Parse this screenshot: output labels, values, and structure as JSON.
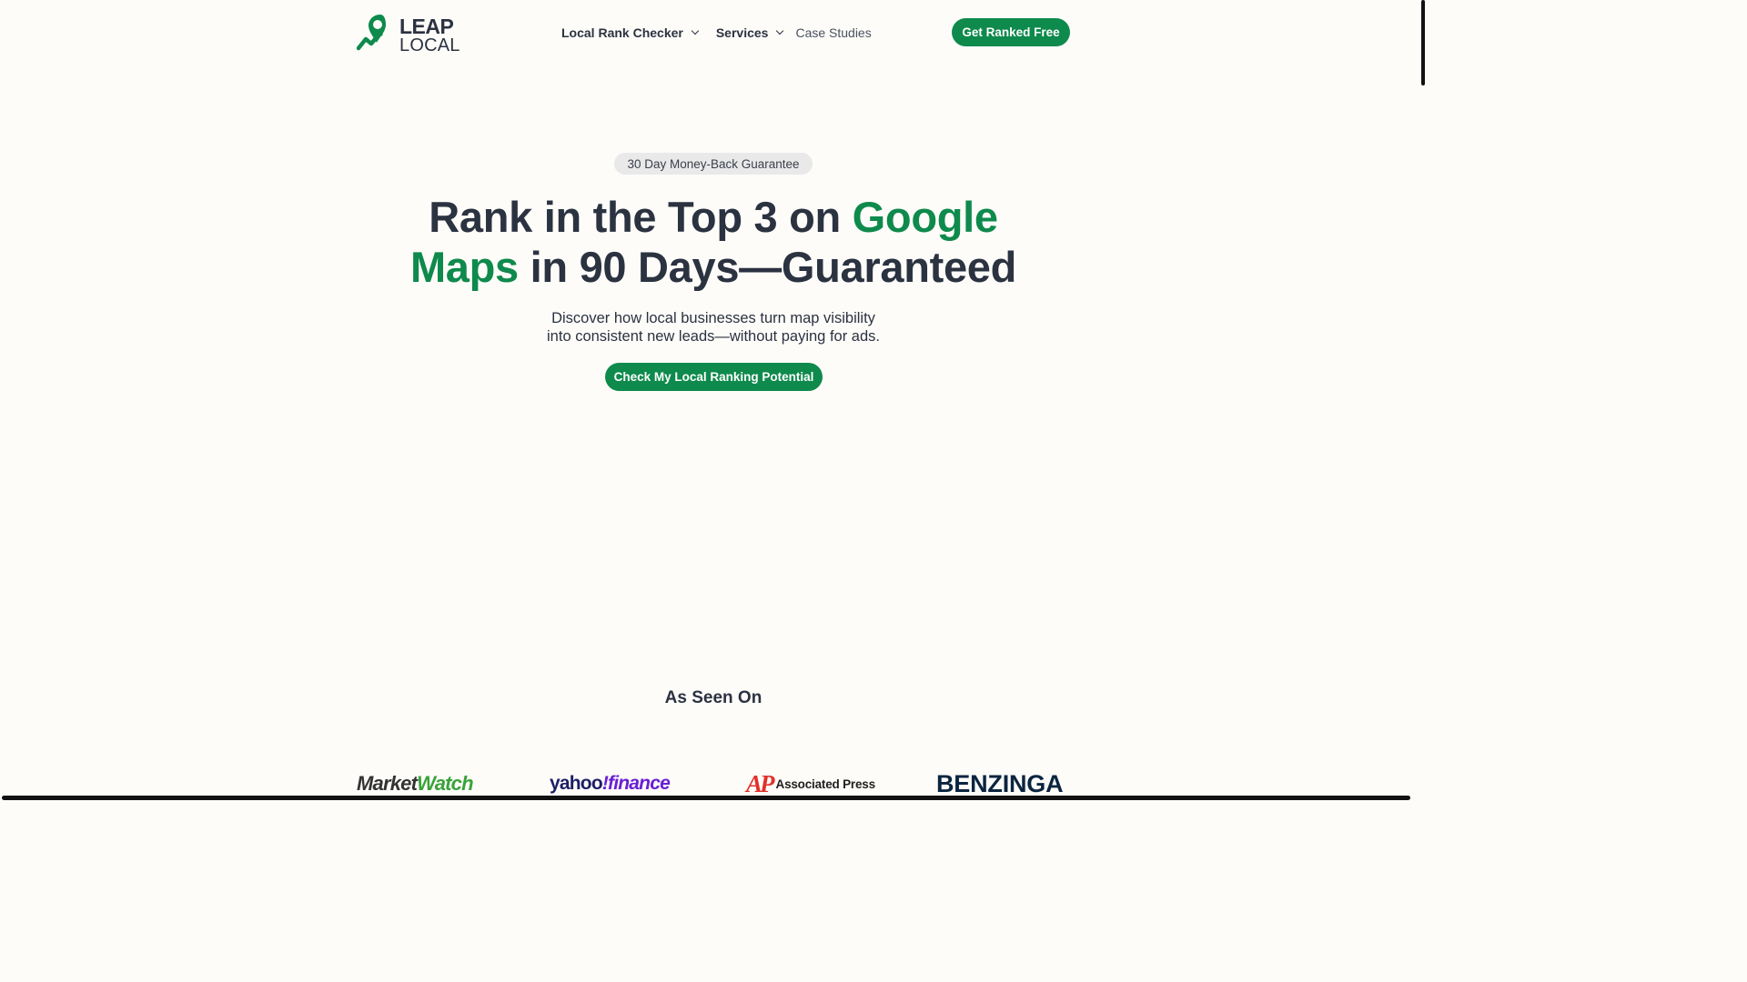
{
  "header": {
    "logo": {
      "line1": "LEAP",
      "line2": "LOCAL"
    },
    "nav": [
      {
        "label": "Local Rank Checker"
      },
      {
        "label": "Services"
      },
      {
        "label": "Case Studies"
      }
    ],
    "cta_label": "Get Ranked Free"
  },
  "hero": {
    "badge": "30 Day Money-Back Guarantee",
    "headline": {
      "part1": "Rank in the Top 3 on ",
      "green1": "Google",
      "green2": "Maps",
      "part2": " in 90 Days—Guaranteed"
    },
    "subtitle": {
      "line1": "Discover how local businesses turn map visibility",
      "line2": "into consistent new leads—without paying for ads."
    },
    "cta_label": "Check My Local Ranking Potential"
  },
  "seen_on": {
    "title": "As Seen On",
    "logos": {
      "marketwatch": {
        "a": "Market",
        "b": "Watch"
      },
      "yahoo": {
        "a": "yahoo",
        "b": "!finance"
      },
      "ap": {
        "mark": "AP",
        "text": "Associated Press"
      },
      "benzinga": "BENZINGA"
    }
  },
  "colors": {
    "brand_green": "#0e8a4c",
    "text_dark": "#2b3240",
    "background": "#fdfcf9",
    "badge_bg": "#e9e9e9"
  },
  "icons": [
    "leap-local-logo-icon",
    "chevron-down-icon"
  ]
}
